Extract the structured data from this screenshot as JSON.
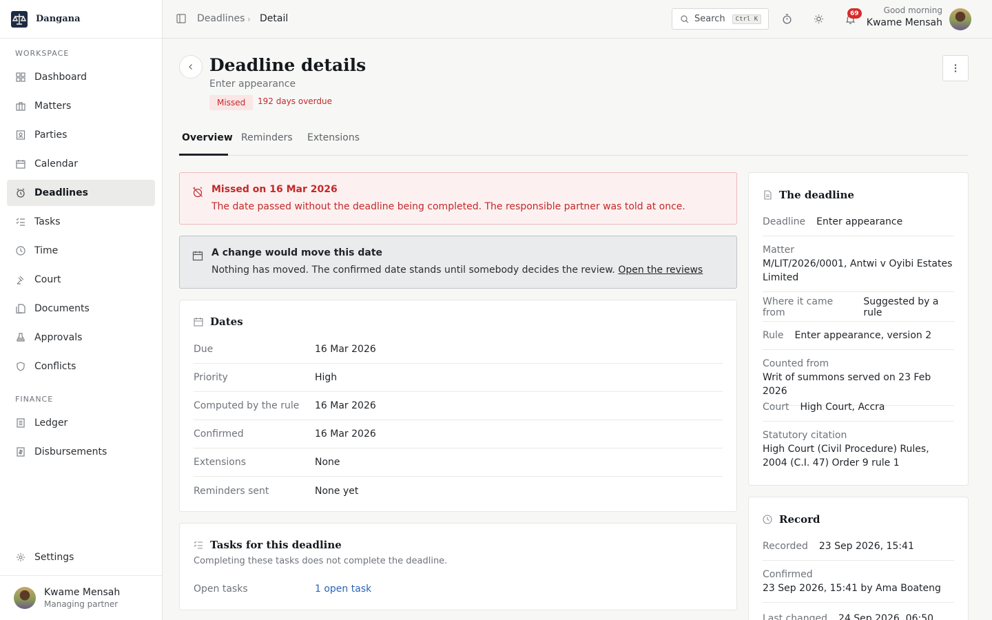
{
  "brand": {
    "name": "Dangana"
  },
  "sidebar": {
    "section_workspace": "WORKSPACE",
    "section_finance": "FINANCE",
    "items": [
      {
        "label": "Dashboard"
      },
      {
        "label": "Matters"
      },
      {
        "label": "Parties"
      },
      {
        "label": "Calendar"
      },
      {
        "label": "Deadlines"
      },
      {
        "label": "Tasks"
      },
      {
        "label": "Time"
      },
      {
        "label": "Court"
      },
      {
        "label": "Documents"
      },
      {
        "label": "Approvals"
      },
      {
        "label": "Conflicts"
      }
    ],
    "finance_items": [
      {
        "label": "Ledger"
      },
      {
        "label": "Disbursements"
      }
    ],
    "settings": "Settings",
    "user": {
      "name": "Kwame Mensah",
      "role": "Managing partner"
    }
  },
  "topbar": {
    "breadcrumb": [
      "Deadlines",
      "Detail"
    ],
    "search_label": "Search",
    "search_shortcut": "Ctrl K",
    "notifications_count": "69",
    "greeting": "Good morning",
    "user_name": "Kwame Mensah"
  },
  "page": {
    "title": "Deadline details",
    "subtitle": "Enter appearance",
    "status": "Missed",
    "overdue": "192 days overdue"
  },
  "tabs": [
    {
      "label": "Overview"
    },
    {
      "label": "Reminders"
    },
    {
      "label": "Extensions"
    }
  ],
  "alerts": {
    "missed_title": "Missed on 16 Mar 2026",
    "missed_body": "The date passed without the deadline being completed. The responsible partner was told at once.",
    "change_title": "A change would move this date",
    "change_body": "Nothing has moved. The confirmed date stands until somebody decides the review.",
    "change_link": "Open the reviews"
  },
  "dates_card": {
    "title": "Dates",
    "rows": [
      {
        "label": "Due",
        "value": "16 Mar 2026"
      },
      {
        "label": "Priority",
        "value": "High"
      },
      {
        "label": "Computed by the rule",
        "value": "16 Mar 2026"
      },
      {
        "label": "Confirmed",
        "value": "16 Mar 2026"
      },
      {
        "label": "Extensions",
        "value": "None"
      },
      {
        "label": "Reminders sent",
        "value": "None yet"
      }
    ]
  },
  "tasks_card": {
    "title": "Tasks for this deadline",
    "note": "Completing these tasks does not complete the deadline.",
    "open_label": "Open tasks",
    "open_value": "1 open task"
  },
  "deadline_card": {
    "title": "The deadline",
    "deadline_label": "Deadline",
    "deadline_value": "Enter appearance",
    "matter_label": "Matter",
    "matter_value": "M/LIT/2026/0001, Antwi v Oyibi Estates Limited",
    "source_label": "Where it came from",
    "source_value": "Suggested by a rule",
    "rule_label": "Rule",
    "rule_value": "Enter appearance, version 2",
    "counted_label": "Counted from",
    "counted_value": "Writ of summons served on 23 Feb 2026",
    "court_label": "Court",
    "court_value": "High Court, Accra",
    "citation_label": "Statutory citation",
    "citation_value": "High Court (Civil Procedure) Rules, 2004 (C.I. 47) Order 9 rule 1"
  },
  "record_card": {
    "title": "Record",
    "recorded_label": "Recorded",
    "recorded_value": "23 Sep 2026, 15:41",
    "confirmed_label": "Confirmed",
    "confirmed_value": "23 Sep 2026, 15:41 by Ama Boateng",
    "changed_label": "Last changed",
    "changed_value": "24 Sep 2026, 06:50"
  }
}
